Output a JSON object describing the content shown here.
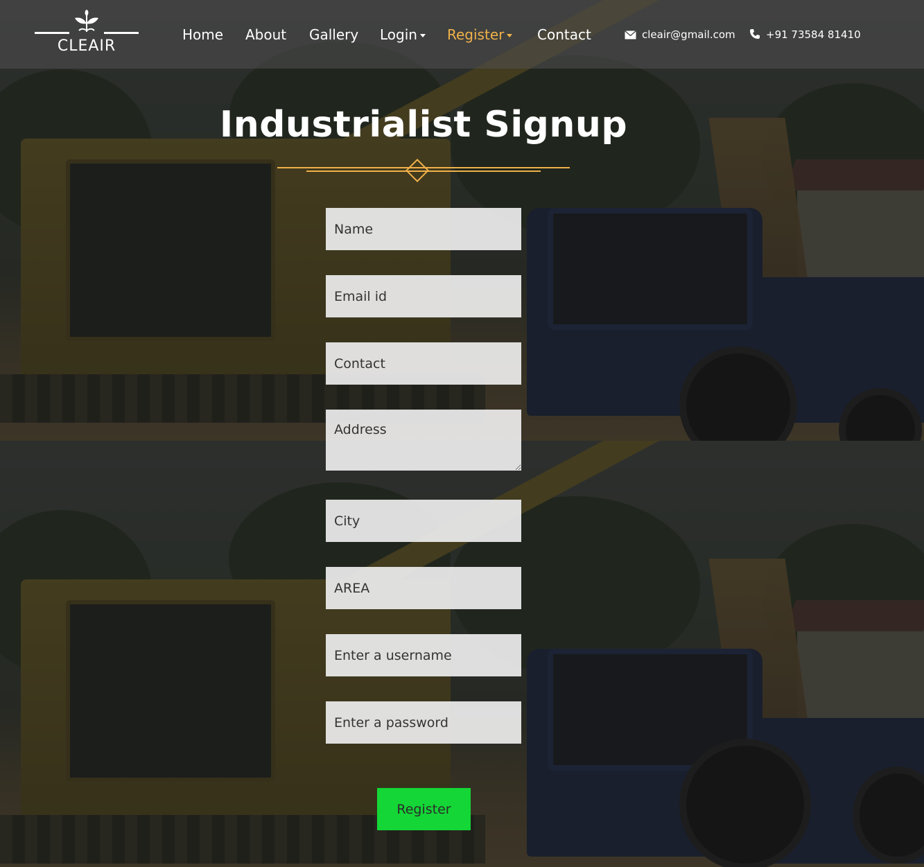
{
  "brand": {
    "name": "CLEAIR"
  },
  "nav": {
    "home": "Home",
    "about": "About",
    "gallery": "Gallery",
    "login": "Login",
    "register": "Register",
    "contact": "Contact"
  },
  "header_contact": {
    "email": "cleair@gmail.com",
    "phone": "+91 73584 81410",
    "email_icon": "envelope-icon",
    "phone_icon": "phone-icon"
  },
  "page": {
    "title": "Industrialist Signup"
  },
  "form": {
    "name_placeholder": "Name",
    "email_placeholder": "Email id",
    "contact_placeholder": "Contact",
    "address_placeholder": "Address",
    "city_placeholder": "City",
    "area_placeholder": "AREA",
    "username_placeholder": "Enter a username",
    "password_placeholder": "Enter a password",
    "submit_label": "Register"
  },
  "colors": {
    "accent": "#f0b14a",
    "submit": "#14d636",
    "field_bg": "#ececec"
  }
}
